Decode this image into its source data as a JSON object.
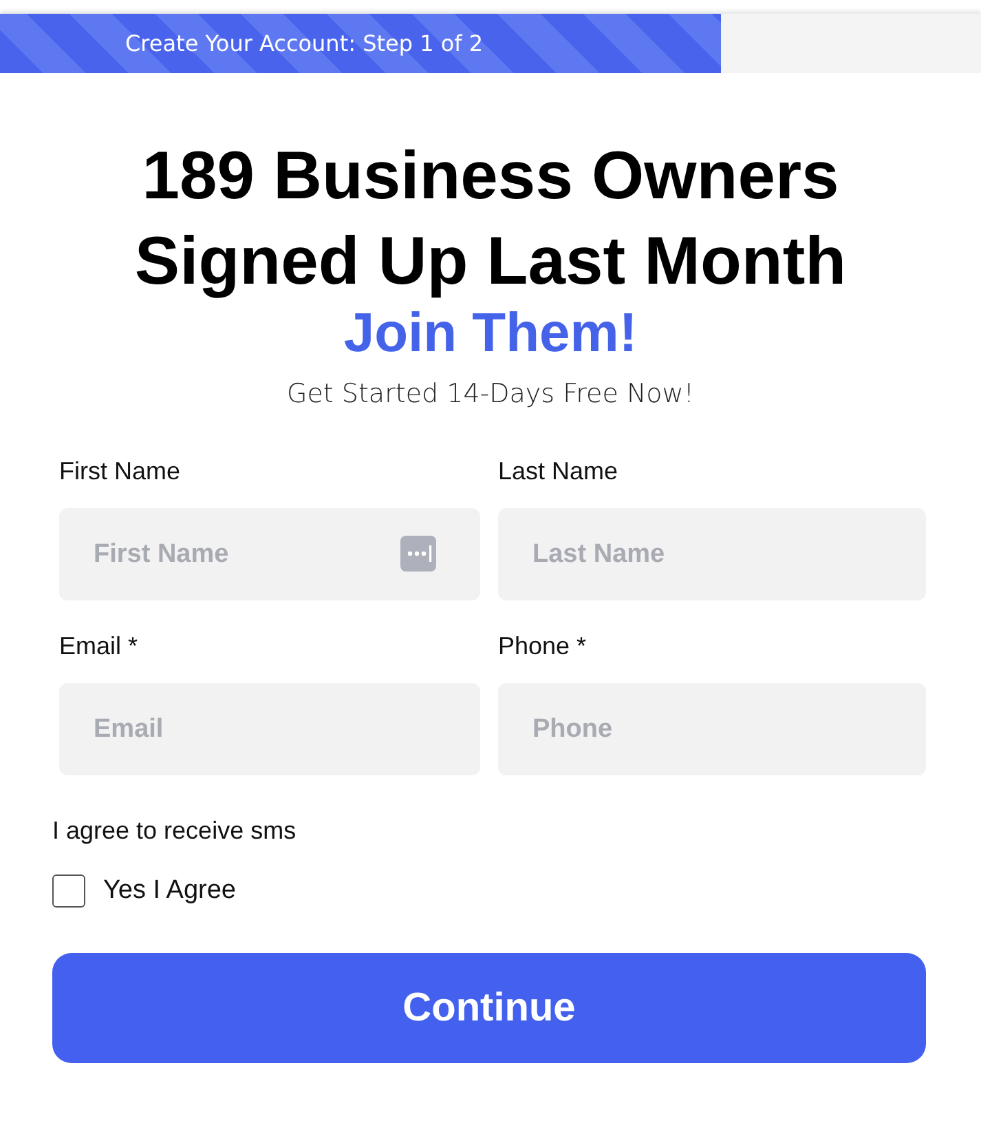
{
  "progress": {
    "label": "Create Your Account: Step 1 of 2",
    "level": 0.735
  },
  "headline": [
    "189 Business Owners",
    "Signed Up Last Month"
  ],
  "highlight": "Join Them!",
  "subtitle": "Get Started 14-Days Free Now!",
  "fields": [
    {
      "label": "First Name",
      "placeholder": "First Name",
      "autofill_icon": true
    },
    {
      "label": "Last Name",
      "placeholder": "Last Name",
      "autofill_icon": false
    },
    {
      "label": "Email *",
      "placeholder": "Email",
      "autofill_icon": false
    },
    {
      "label": "Phone *",
      "placeholder": "Phone",
      "autofill_icon": false
    }
  ],
  "consent": {
    "question": "I agree to receive sms",
    "option": "Yes I Agree",
    "checked": false
  },
  "button": "Continue"
}
